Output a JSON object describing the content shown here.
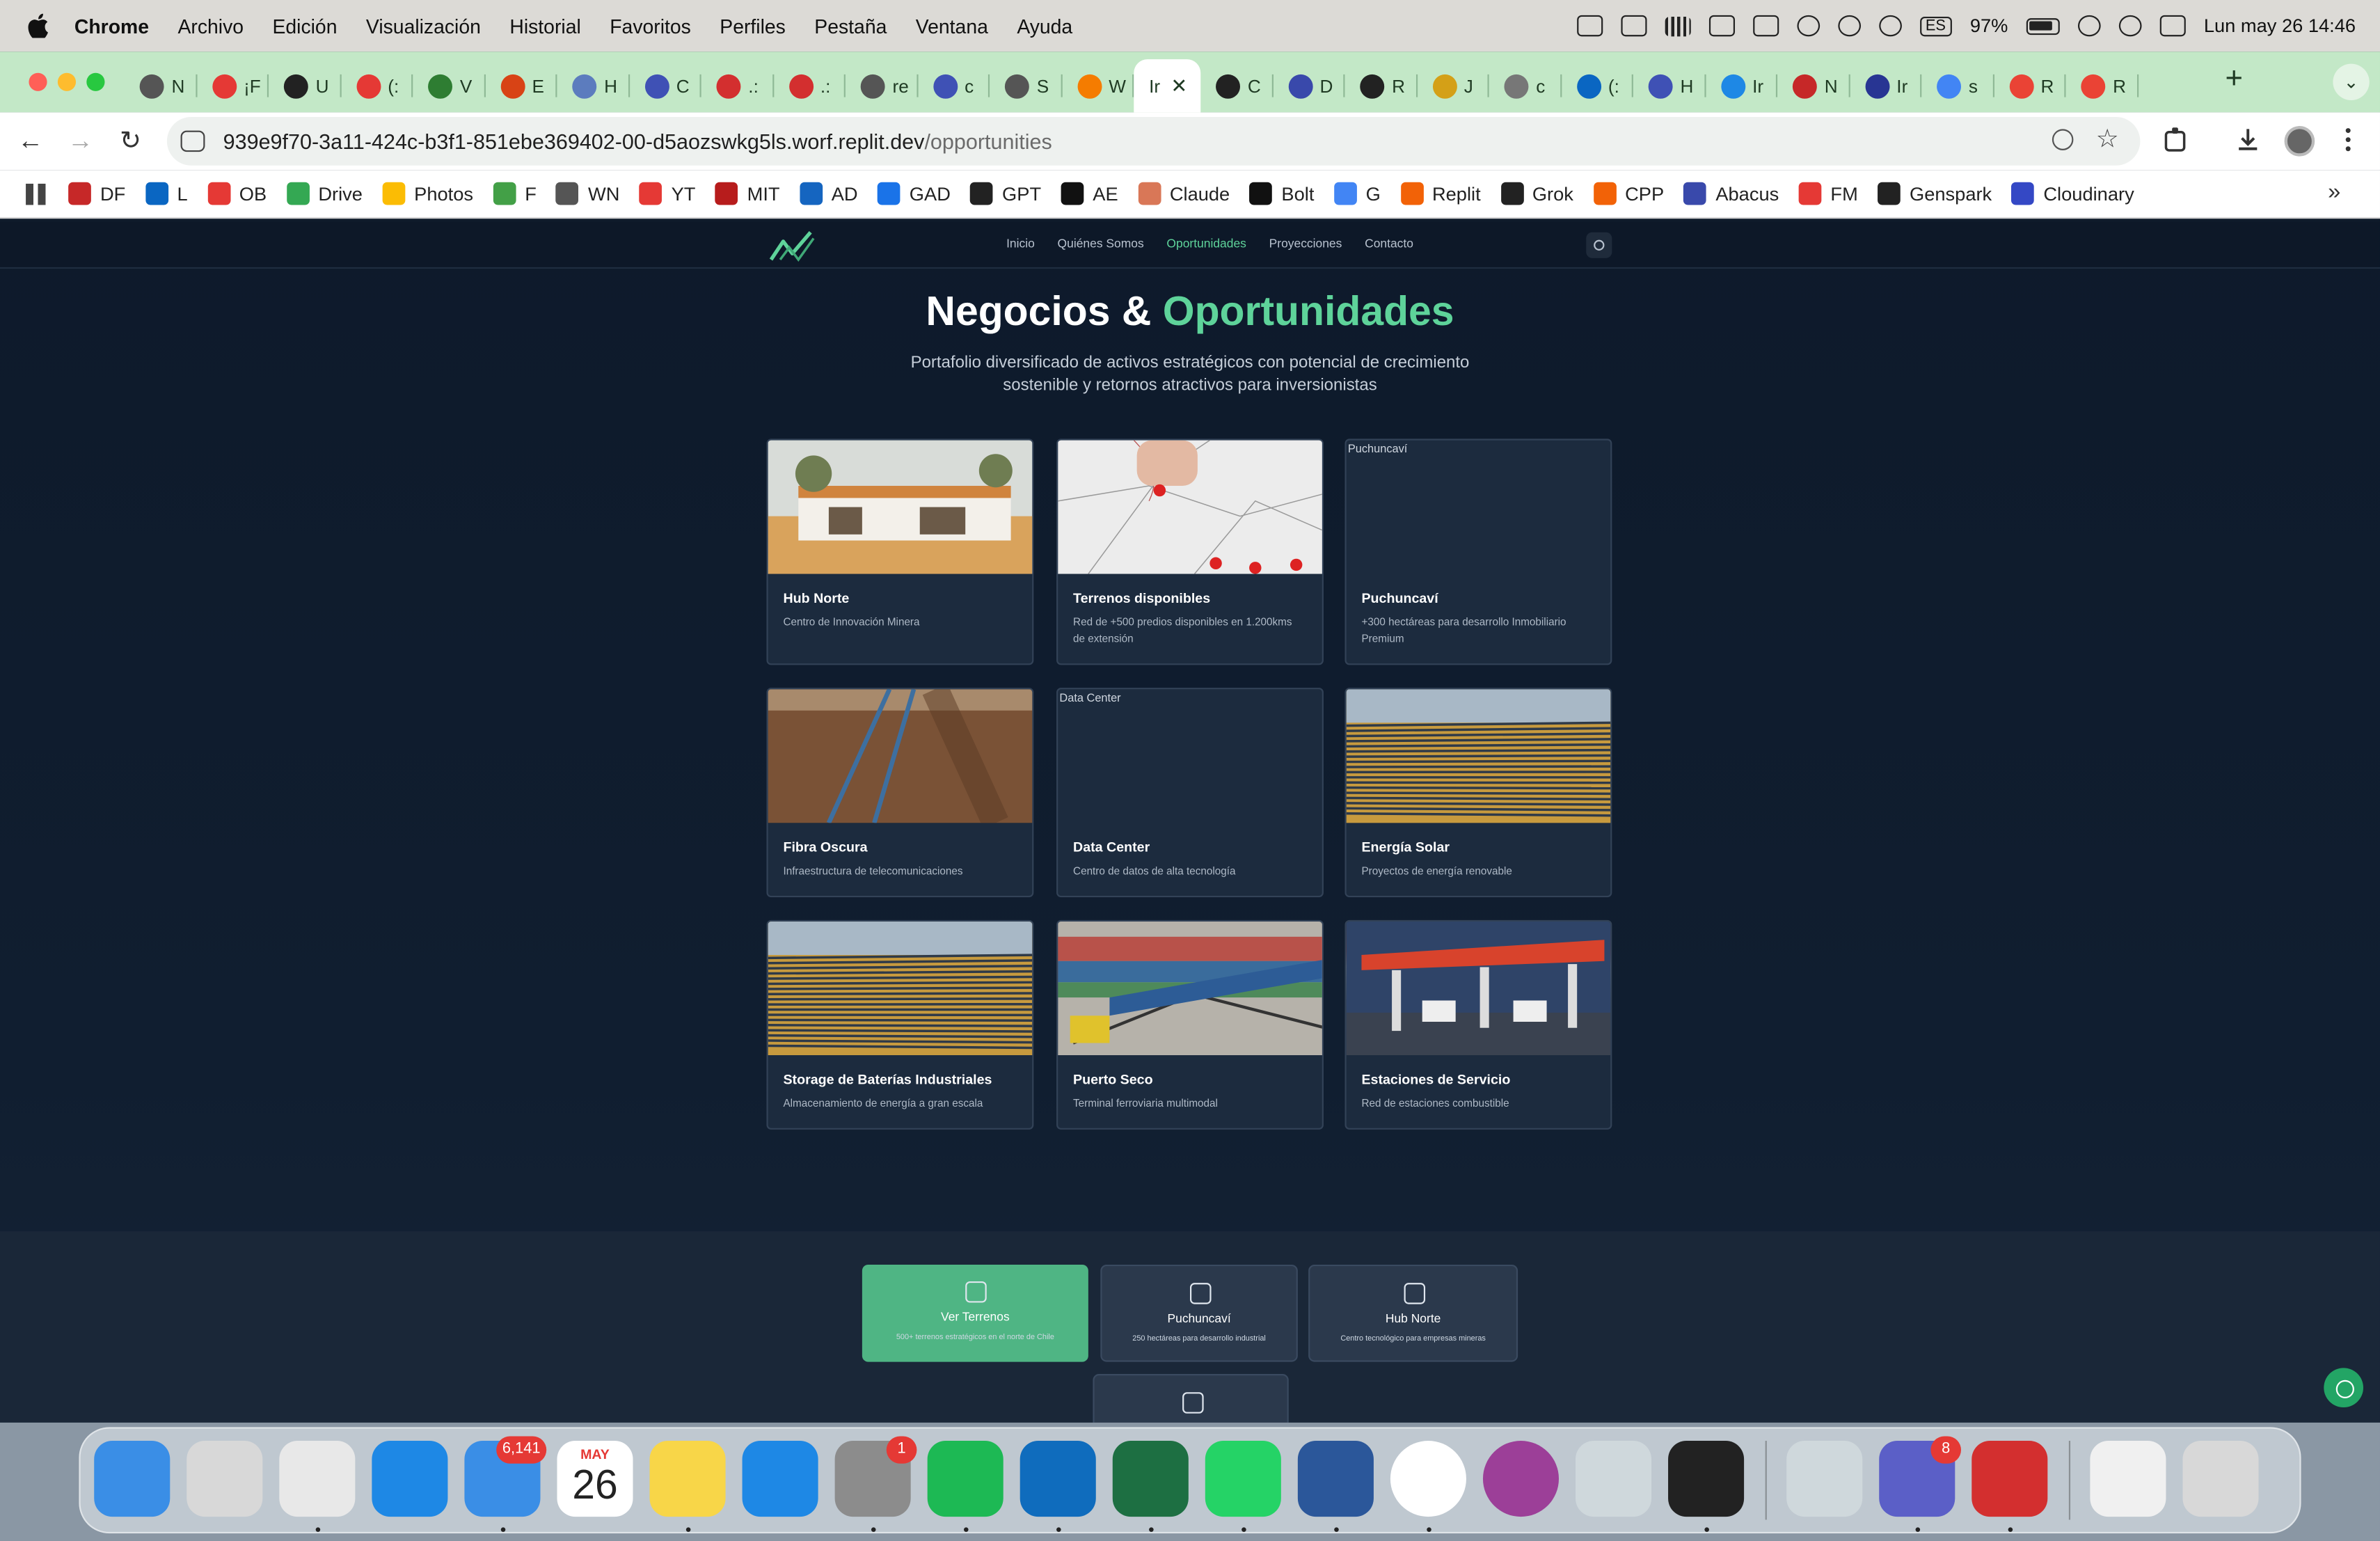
{
  "menubar": {
    "app_name": "Chrome",
    "items": [
      "Archivo",
      "Edición",
      "Visualización",
      "Historial",
      "Favoritos",
      "Perfiles",
      "Pestaña",
      "Ventana",
      "Ayuda"
    ],
    "input_source": "ES",
    "battery": "97%",
    "datetime": "Lun may 26  14:46"
  },
  "tabs": [
    {
      "label": "N",
      "color": "#555555"
    },
    {
      "label": "¡F",
      "color": "#e53935"
    },
    {
      "label": "U",
      "color": "#222222"
    },
    {
      "label": "(:",
      "color": "#e53935"
    },
    {
      "label": "V",
      "color": "#2e7d32"
    },
    {
      "label": "E",
      "color": "#d84315"
    },
    {
      "label": "H",
      "color": "#5c7cbe"
    },
    {
      "label": "C",
      "color": "#3f51b5"
    },
    {
      "label": ".:",
      "color": "#d32f2f"
    },
    {
      "label": ".:",
      "color": "#d32f2f"
    },
    {
      "label": "re",
      "color": "#555555"
    },
    {
      "label": "c",
      "color": "#3f51b5"
    },
    {
      "label": "S",
      "color": "#555555"
    },
    {
      "label": "W",
      "color": "#f57c00"
    },
    {
      "label": "Ir",
      "color": "#ffffff",
      "active": true
    },
    {
      "label": "C",
      "color": "#222222"
    },
    {
      "label": "D",
      "color": "#3949ab"
    },
    {
      "label": "R",
      "color": "#222222"
    },
    {
      "label": "J",
      "color": "#d4a017"
    },
    {
      "label": "c",
      "color": "#777777"
    },
    {
      "label": "(:",
      "color": "#0a66c2"
    },
    {
      "label": "H",
      "color": "#3f51b5"
    },
    {
      "label": "Ir",
      "color": "#1e88e5"
    },
    {
      "label": "N",
      "color": "#c62828"
    },
    {
      "label": "Ir",
      "color": "#283593"
    },
    {
      "label": "s",
      "color": "#4285f4"
    },
    {
      "label": "R",
      "color": "#ea4335"
    },
    {
      "label": "R",
      "color": "#ea4335"
    }
  ],
  "toolbar": {
    "url_host": "939e9f70-3a11-424c-b3f1-851ebe369402-00-d5aozswkg5ls.worf.replit.dev",
    "url_path": "/opportunities"
  },
  "bookmarks": [
    {
      "label": "DF",
      "color": "#c62828"
    },
    {
      "label": "L",
      "color": "#0a66c2"
    },
    {
      "label": "OB",
      "color": "#e53935"
    },
    {
      "label": "Drive",
      "color": "#34a853"
    },
    {
      "label": "Photos",
      "color": "#fbbc04"
    },
    {
      "label": "F",
      "color": "#43a047"
    },
    {
      "label": "WN",
      "color": "#555555"
    },
    {
      "label": "YT",
      "color": "#e53935"
    },
    {
      "label": "MIT",
      "color": "#b71c1c"
    },
    {
      "label": "AD",
      "color": "#1565c0"
    },
    {
      "label": "GAD",
      "color": "#1a73e8"
    },
    {
      "label": "GPT",
      "color": "#222222"
    },
    {
      "label": "AE",
      "color": "#111111"
    },
    {
      "label": "Claude",
      "color": "#d97757"
    },
    {
      "label": "Bolt",
      "color": "#111111"
    },
    {
      "label": "G",
      "color": "#4285f4"
    },
    {
      "label": "Replit",
      "color": "#f26207"
    },
    {
      "label": "Grok",
      "color": "#222222"
    },
    {
      "label": "CPP",
      "color": "#f26207"
    },
    {
      "label": "Abacus",
      "color": "#3949ab"
    },
    {
      "label": "FM",
      "color": "#e53935"
    },
    {
      "label": "Genspark",
      "color": "#222222"
    },
    {
      "label": "Cloudinary",
      "color": "#3448c5"
    }
  ],
  "site": {
    "nav": [
      "Inicio",
      "Quiénes Somos",
      "Oportunidades",
      "Proyecciones",
      "Contacto"
    ],
    "active_nav": "Oportunidades",
    "accent_color": "#5ed39a",
    "hero_title_main": "Negocios &",
    "hero_title_accent": "Oportunidades",
    "hero_subtitle": "Portafolio diversificado de activos estratégicos con potencial de crecimiento sostenible y retornos atractivos para inversionistas",
    "cards": [
      {
        "title": "Hub Norte",
        "desc": "Centro de Innovación Minera",
        "image": "house"
      },
      {
        "title": "Terrenos disponibles",
        "desc": "Red de +500 predios disponibles en 1.200kms de extensión",
        "image": "map"
      },
      {
        "title": "Puchuncaví",
        "desc": "+300 hectáreas para desarrollo Inmobiliario Premium",
        "image": "broken",
        "alt": "Puchuncaví"
      },
      {
        "title": "Fibra Oscura",
        "desc": "Infraestructura de telecomunicaciones",
        "image": "trench"
      },
      {
        "title": "Data Center",
        "desc": "Centro de datos de alta tecnología",
        "image": "broken",
        "alt": "Data Center"
      },
      {
        "title": "Energía Solar",
        "desc": "Proyectos de energía renovable",
        "image": "solar"
      },
      {
        "title": "Storage de Baterías Industriales",
        "desc": "Almacenamiento de energía a gran escala",
        "image": "solar"
      },
      {
        "title": "Puerto Seco",
        "desc": "Terminal ferroviaria multimodal",
        "image": "train"
      },
      {
        "title": "Estaciones de Servicio",
        "desc": "Red de estaciones combustible",
        "image": "station"
      }
    ],
    "actions": [
      {
        "title": "Ver Terrenos",
        "desc": "500+ terrenos estratégicos en el norte de Chile",
        "icon": "map-pin-icon",
        "primary": true
      },
      {
        "title": "Puchuncaví",
        "desc": "250 hectáreas para desarrollo industrial",
        "icon": "factory-icon"
      },
      {
        "title": "Hub Norte",
        "desc": "Centro tecnológico para empresas mineras",
        "icon": "building-icon"
      },
      {
        "title": "",
        "desc": "",
        "icon": "network-icon"
      }
    ]
  },
  "dock": [
    {
      "name": "finder",
      "color": "#3a8ee6"
    },
    {
      "name": "launchpad",
      "color": "#d8d8d8"
    },
    {
      "name": "chrome",
      "color": "#e8e8e8",
      "running": true
    },
    {
      "name": "safari",
      "color": "#1e88e5"
    },
    {
      "name": "mail",
      "color": "#3a8ee6",
      "badge": "6,141",
      "running": true
    },
    {
      "name": "calendar",
      "color": "#ffffff",
      "month": "MAY",
      "day": "26"
    },
    {
      "name": "notes",
      "color": "#f8d648",
      "running": true
    },
    {
      "name": "keynote",
      "color": "#1e88e5"
    },
    {
      "name": "system-settings",
      "color": "#8c8c8c",
      "badge": "1",
      "running": true
    },
    {
      "name": "spotify",
      "color": "#1db954",
      "running": true
    },
    {
      "name": "outlook",
      "color": "#0f6cbd",
      "running": true
    },
    {
      "name": "excel",
      "color": "#1d6f42",
      "running": true
    },
    {
      "name": "whatsapp",
      "color": "#25d366",
      "running": true
    },
    {
      "name": "word",
      "color": "#2b579a",
      "running": true
    },
    {
      "name": "fantastical",
      "color": "#ffffff",
      "running": true
    },
    {
      "name": "screen-recorder",
      "color": "#9c3f98"
    },
    {
      "name": "iphone-mirroring",
      "color": "#cfd8dc"
    },
    {
      "name": "replit",
      "color": "#222222",
      "running": true
    },
    {
      "name": "preview",
      "color": "#cfd8dc"
    },
    {
      "name": "teams",
      "color": "#5b5fc7",
      "badge": "8",
      "running": true
    },
    {
      "name": "acrobat",
      "color": "#d32f2f",
      "running": true
    },
    {
      "name": "site-preview",
      "color": "#f0f0f0"
    },
    {
      "name": "trash",
      "color": "#d8d8d8"
    }
  ]
}
